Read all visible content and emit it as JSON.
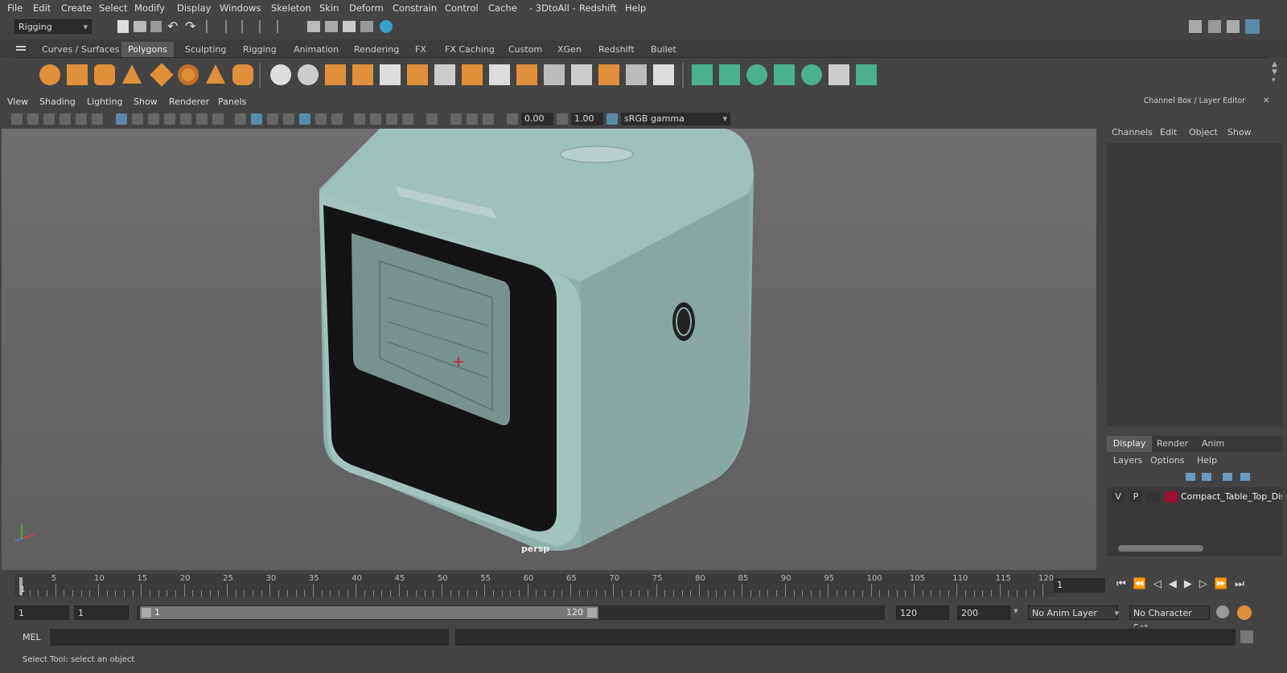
{
  "menu": [
    "File",
    "Edit",
    "Create",
    "Select",
    "Modify",
    "Display",
    "Windows",
    "Skeleton",
    "Skin",
    "Deform",
    "Constrain",
    "Control",
    "Cache",
    "- 3DtoAll -",
    "Redshift",
    "Help"
  ],
  "mode_selector": "Rigging",
  "shelf_tabs": [
    "Curves / Surfaces",
    "Polygons",
    "Sculpting",
    "Rigging",
    "Animation",
    "Rendering",
    "FX",
    "FX Caching",
    "Custom",
    "XGen",
    "Redshift",
    "Bullet"
  ],
  "active_shelf_tab": "Polygons",
  "panel_menu": [
    "View",
    "Shading",
    "Lighting",
    "Show",
    "Renderer",
    "Panels"
  ],
  "viewport": {
    "exposure": "0.00",
    "gamma": "1.00",
    "color_space": "sRGB gamma",
    "camera_label": "persp"
  },
  "channel_box": {
    "title": "Channel Box / Layer Editor",
    "menu": [
      "Channels",
      "Edit",
      "Object",
      "Show"
    ]
  },
  "layer_editor": {
    "tabs": [
      "Display",
      "Render",
      "Anim"
    ],
    "active_tab": "Display",
    "menu": [
      "Layers",
      "Options",
      "Help"
    ],
    "layer": {
      "v": "V",
      "p": "P",
      "name": "Compact_Table_Top_Dish",
      "color": "#9a1030"
    }
  },
  "timeline": {
    "ticks": [
      5,
      10,
      15,
      20,
      25,
      30,
      35,
      40,
      45,
      50,
      55,
      60,
      65,
      70,
      75,
      80,
      85,
      90,
      95,
      100,
      105,
      110,
      115,
      120
    ],
    "start_marker": "1",
    "current_frame": "1"
  },
  "range": {
    "start": "1",
    "playback_start": "1",
    "slider_start": "1",
    "slider_end": "120",
    "playback_end": "120",
    "end": "200",
    "anim_layer": "No Anim Layer",
    "char_set": "No Character Set"
  },
  "cmd": {
    "label": "MEL"
  },
  "status": "Select Tool: select an object"
}
